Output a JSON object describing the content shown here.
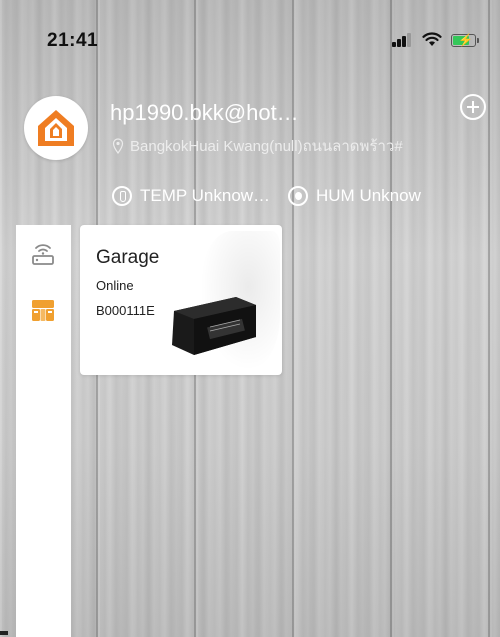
{
  "status_bar": {
    "time": "21:41",
    "icons": [
      "cellular-signal-icon",
      "wifi-icon",
      "battery-charging-icon"
    ]
  },
  "header": {
    "avatar_icon": "home-logo-icon",
    "user_name": "hp1990.bkk@hot…",
    "location_icon": "location-pin-icon",
    "location": "BangkokHuai Kwang(null)ถนนลาดพร้าว#",
    "add_icon": "plus-circle-icon"
  },
  "environment": {
    "temp_icon": "thermometer-icon",
    "temp_label": "TEMP Unknow…",
    "hum_icon": "humidity-icon",
    "hum_label": "HUM Unknow"
  },
  "sidebar": {
    "items": [
      {
        "icon": "router-icon",
        "color": "#8a8a8a"
      },
      {
        "icon": "device-group-icon",
        "color": "#f0a030"
      }
    ]
  },
  "devices": [
    {
      "name": "Garage",
      "status": "Online",
      "id": "B000111E",
      "image_icon": "garage-controller-device-image"
    }
  ],
  "colors": {
    "accent": "#f0a030",
    "logo_orange": "#ef7d22",
    "card_bg": "#ffffff"
  }
}
